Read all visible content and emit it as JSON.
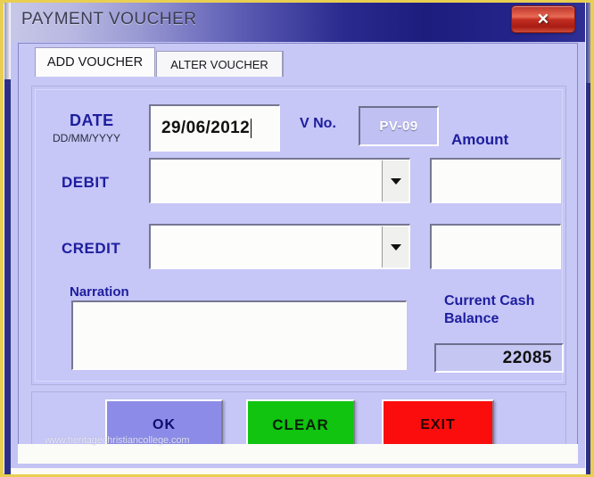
{
  "window": {
    "title": "PAYMENT VOUCHER",
    "close_label": "✕",
    "close_icon": "close-icon"
  },
  "tabs": [
    {
      "label": "ADD VOUCHER",
      "active": true
    },
    {
      "label": "ALTER VOUCHER",
      "active": false
    }
  ],
  "form": {
    "date": {
      "label": "DATE",
      "format_hint": "DD/MM/YYYY",
      "value": "29/06/2012",
      "placeholder": ""
    },
    "voucher_no": {
      "label": "V No.",
      "value": "PV-09"
    },
    "amount": {
      "label": "Amount"
    },
    "debit": {
      "label": "DEBIT",
      "value": "",
      "placeholder": "",
      "amount_value": "",
      "dropdown_icon": "chevron-down-icon"
    },
    "credit": {
      "label": "CREDIT",
      "value": "",
      "placeholder": "",
      "amount_value": "",
      "dropdown_icon": "chevron-down-icon"
    },
    "narration": {
      "label": "Narration",
      "value": "",
      "placeholder": ""
    },
    "cash_balance": {
      "label": "Current Cash Balance",
      "value": "22085"
    }
  },
  "buttons": {
    "ok": "OK",
    "clear": "CLEAR",
    "exit": "EXIT"
  },
  "watermark": "www.heritagechristiancollege.com",
  "colors": {
    "titlebar_dark": "#1d1d7e",
    "titlebar_light": "#c7c7e8",
    "panel": "#c6c6f7",
    "label_blue": "#1d1d9e",
    "close_red": "#c22d22",
    "ok_button": "#8c8ce8",
    "clear_button": "#10c410",
    "exit_button": "#fb0d0d",
    "outer_border_yellow": "#e8cf52",
    "frame_navy": "#2b2f86"
  }
}
